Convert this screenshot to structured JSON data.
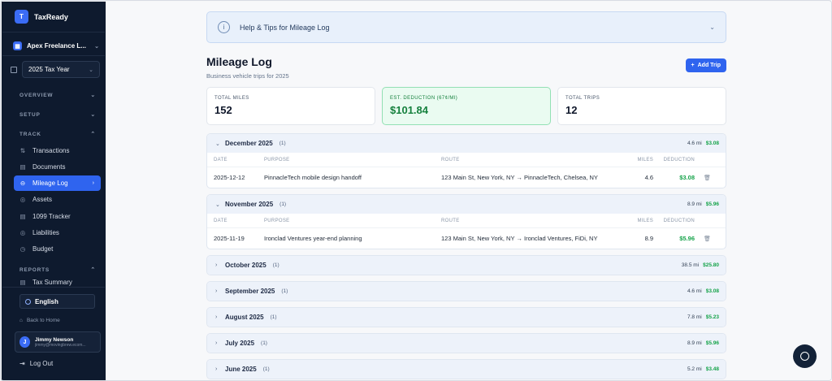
{
  "app": {
    "logo_letter": "T",
    "name": "TaxReady"
  },
  "org": {
    "name": "Apex Freelance L..."
  },
  "tax_year": {
    "value": "2025 Tax Year"
  },
  "sidebar": {
    "sections": {
      "overview": "OVERVIEW",
      "setup": "SETUP",
      "track": "TRACK",
      "reports": "REPORTS"
    },
    "items": [
      {
        "label": "Transactions",
        "icon": "transactions-icon"
      },
      {
        "label": "Documents",
        "icon": "document-icon"
      },
      {
        "label": "Mileage Log",
        "icon": "car-icon",
        "active": true
      },
      {
        "label": "Assets",
        "icon": "assets-icon"
      },
      {
        "label": "1099 Tracker",
        "icon": "tracker-icon"
      },
      {
        "label": "Liabilities",
        "icon": "liabilities-icon"
      },
      {
        "label": "Budget",
        "icon": "budget-icon"
      }
    ],
    "partial_item": "Tax Summary",
    "language": "English",
    "back_home": "Back to Home",
    "user": {
      "initial": "J",
      "name": "Jimmy Newson",
      "email": "jimmy@movingbrew.ecom..."
    },
    "logout": "Log Out"
  },
  "help": {
    "label": "Help & Tips for Mileage Log"
  },
  "page": {
    "title": "Mileage Log",
    "subtitle": "Business vehicle trips for 2025",
    "add_button": "Add Trip"
  },
  "stats": [
    {
      "label": "TOTAL MILES",
      "value": "152"
    },
    {
      "label": "EST. DEDUCTION (67¢/MI)",
      "value": "$101.84"
    },
    {
      "label": "TOTAL TRIPS",
      "value": "12"
    }
  ],
  "table_headers": {
    "date": "DATE",
    "purpose": "PURPOSE",
    "route": "ROUTE",
    "miles": "MILES",
    "deduction": "DEDUCTION"
  },
  "groups": [
    {
      "month": "December 2025",
      "count": "(1)",
      "miles": "4.6 mi",
      "deduction": "$3.08",
      "expanded": true,
      "rows": [
        {
          "date": "2025-12-12",
          "purpose": "PinnacleTech mobile design handoff",
          "route": "123 Main St, New York, NY → PinnacleTech, Chelsea, NY",
          "miles": "4.6",
          "deduction": "$3.08"
        }
      ]
    },
    {
      "month": "November 2025",
      "count": "(1)",
      "miles": "8.9 mi",
      "deduction": "$5.96",
      "expanded": true,
      "rows": [
        {
          "date": "2025-11-19",
          "purpose": "Ironclad Ventures year-end planning",
          "route": "123 Main St, New York, NY → Ironclad Ventures, FiDi, NY",
          "miles": "8.9",
          "deduction": "$5.96"
        }
      ]
    },
    {
      "month": "October 2025",
      "count": "(1)",
      "miles": "38.5 mi",
      "deduction": "$25.80",
      "expanded": false
    },
    {
      "month": "September 2025",
      "count": "(1)",
      "miles": "4.6 mi",
      "deduction": "$3.08",
      "expanded": false
    },
    {
      "month": "August 2025",
      "count": "(1)",
      "miles": "7.8 mi",
      "deduction": "$5.23",
      "expanded": false
    },
    {
      "month": "July 2025",
      "count": "(1)",
      "miles": "8.9 mi",
      "deduction": "$5.96",
      "expanded": false
    },
    {
      "month": "June 2025",
      "count": "(1)",
      "miles": "5.2 mi",
      "deduction": "$3.48",
      "expanded": false
    }
  ]
}
